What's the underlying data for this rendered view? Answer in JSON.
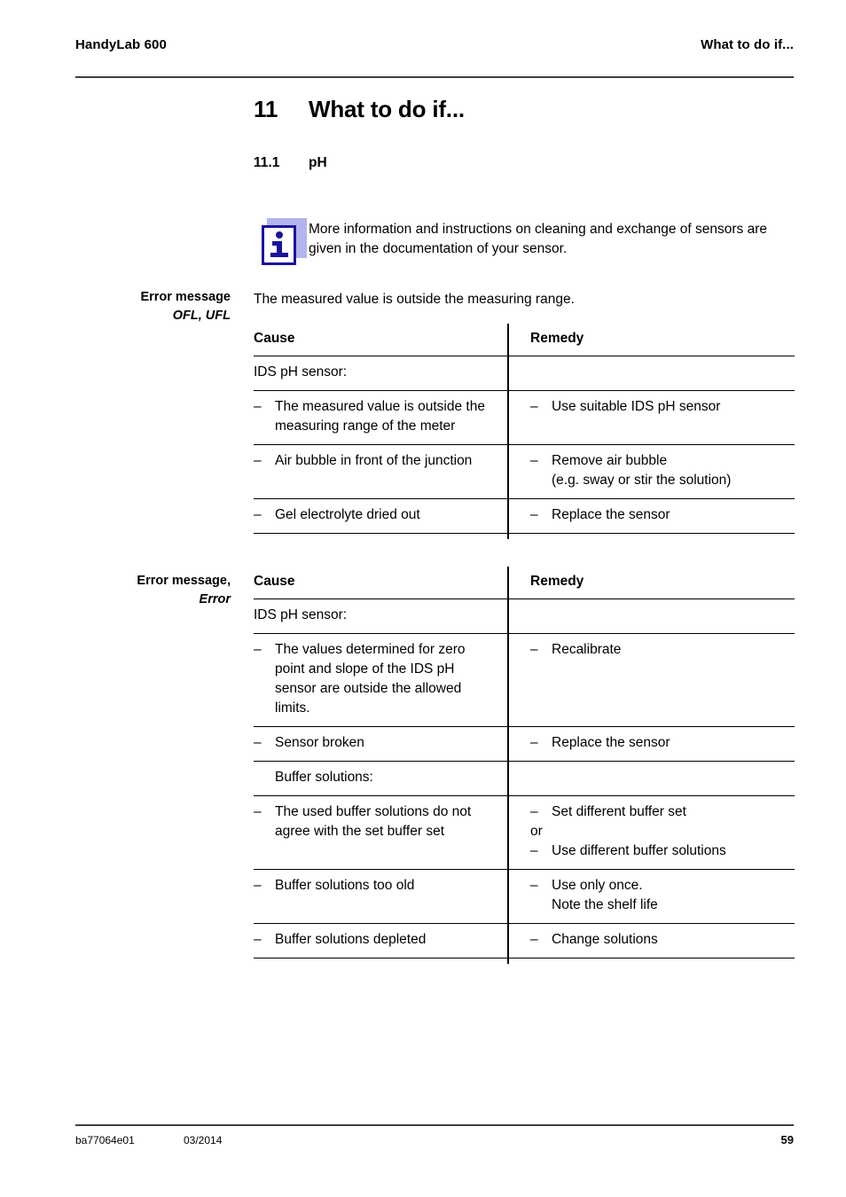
{
  "running_head": {
    "left": "HandyLab 600",
    "right": "What to do if..."
  },
  "chapter": {
    "number": "11",
    "title": "What to do if..."
  },
  "section": {
    "number": "11.1",
    "title": "pH"
  },
  "note": {
    "icon": "info-icon",
    "text": "More information and instructions on cleaning and exchange of sensors are given in the documentation of your sensor.",
    "border_color": "#1a149b",
    "shadow_color": "#b3b3ee"
  },
  "blocks": [
    {
      "margin_label_line1": "Error message",
      "margin_label_line2": "OFL, UFL",
      "intro": "The measured value is outside the measuring range.",
      "table": {
        "headers": [
          "Cause",
          "Remedy"
        ],
        "rows": [
          {
            "cause": {
              "style": "plain",
              "lines": [
                "IDS pH sensor:"
              ]
            },
            "remedy": {
              "style": "empty",
              "lines": []
            }
          },
          {
            "cause": {
              "style": "dash",
              "lines": [
                "The measured value is outside the measuring range of the meter"
              ]
            },
            "remedy": {
              "style": "dash",
              "lines": [
                "Use suitable IDS pH sensor"
              ]
            }
          },
          {
            "cause": {
              "style": "dash",
              "lines": [
                "Air bubble in front of the junction"
              ]
            },
            "remedy": {
              "style": "dash",
              "lines": [
                "Remove air bubble",
                "(e.g. sway or stir the solution)"
              ]
            }
          },
          {
            "cause": {
              "style": "dash",
              "lines": [
                "Gel electrolyte dried out"
              ]
            },
            "remedy": {
              "style": "dash",
              "lines": [
                "Replace the sensor"
              ]
            }
          }
        ]
      }
    },
    {
      "margin_label_line1": "Error message,",
      "margin_label_line2": "Error",
      "intro": "",
      "table": {
        "headers": [
          "Cause",
          "Remedy"
        ],
        "rows": [
          {
            "cause": {
              "style": "plain",
              "lines": [
                "IDS pH sensor:"
              ]
            },
            "remedy": {
              "style": "empty",
              "lines": []
            }
          },
          {
            "cause": {
              "style": "dash",
              "lines": [
                "The values determined for zero point and slope of the IDS pH sensor are outside the allowed limits."
              ]
            },
            "remedy": {
              "style": "dash",
              "lines": [
                "Recalibrate"
              ]
            }
          },
          {
            "cause": {
              "style": "dash",
              "lines": [
                "Sensor broken"
              ]
            },
            "remedy": {
              "style": "dash",
              "lines": [
                "Replace the sensor"
              ]
            }
          },
          {
            "cause": {
              "style": "plain-indent",
              "lines": [
                "Buffer solutions:"
              ]
            },
            "remedy": {
              "style": "empty",
              "lines": []
            }
          },
          {
            "cause": {
              "style": "dash",
              "lines": [
                "The used buffer solutions do not agree with the set buffer set"
              ]
            },
            "remedy": {
              "style": "dash-or-dash",
              "first": "Set different buffer set",
              "conjunction": "or",
              "second": "Use different buffer solutions"
            }
          },
          {
            "cause": {
              "style": "dash",
              "lines": [
                "Buffer solutions too old"
              ]
            },
            "remedy": {
              "style": "dash",
              "lines": [
                "Use only once.",
                "Note the shelf life"
              ]
            }
          },
          {
            "cause": {
              "style": "dash",
              "lines": [
                "Buffer solutions depleted"
              ]
            },
            "remedy": {
              "style": "dash",
              "lines": [
                "Change solutions"
              ]
            }
          }
        ]
      }
    }
  ],
  "footer": {
    "doc_id": "ba77064e01",
    "date": "03/2014",
    "page_number": "59"
  },
  "dash_glyph": "–"
}
